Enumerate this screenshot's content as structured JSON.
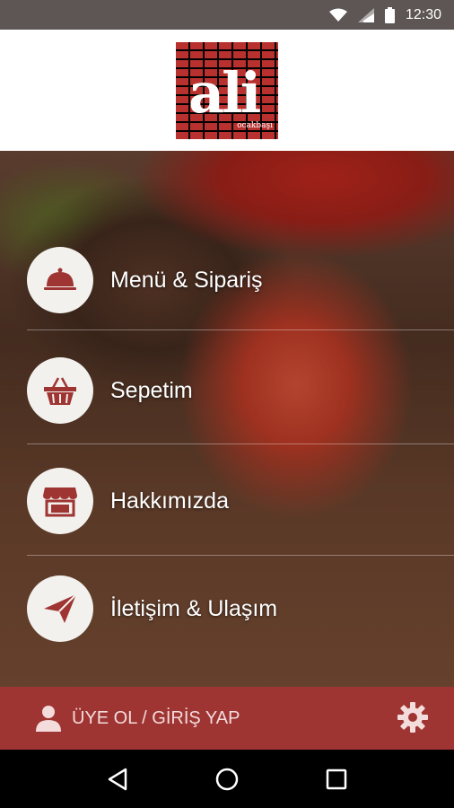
{
  "status_bar": {
    "time": "12:30",
    "icons": [
      "wifi-icon",
      "signal-icon",
      "battery-icon"
    ]
  },
  "header": {
    "logo_text": "ali",
    "logo_subtext": "ocakbaşı"
  },
  "menu": {
    "items": [
      {
        "label": "Menü & Sipariş",
        "icon": "cloche-icon"
      },
      {
        "label": "Sepetim",
        "icon": "basket-icon"
      },
      {
        "label": "Hakkımızda",
        "icon": "storefront-icon"
      },
      {
        "label": "İletişim & Ulaşım",
        "icon": "paper-plane-icon"
      }
    ]
  },
  "bottom_bar": {
    "login_label": "ÜYE OL / GİRİŞ YAP",
    "user_icon": "user-icon",
    "settings_icon": "gear-icon"
  },
  "colors": {
    "accent": "#9e3533",
    "status_bar": "#5d5654",
    "icon_circle": "#f3f1ee"
  },
  "nav_bar": {
    "buttons": [
      "back-icon",
      "home-icon",
      "recents-icon"
    ]
  }
}
